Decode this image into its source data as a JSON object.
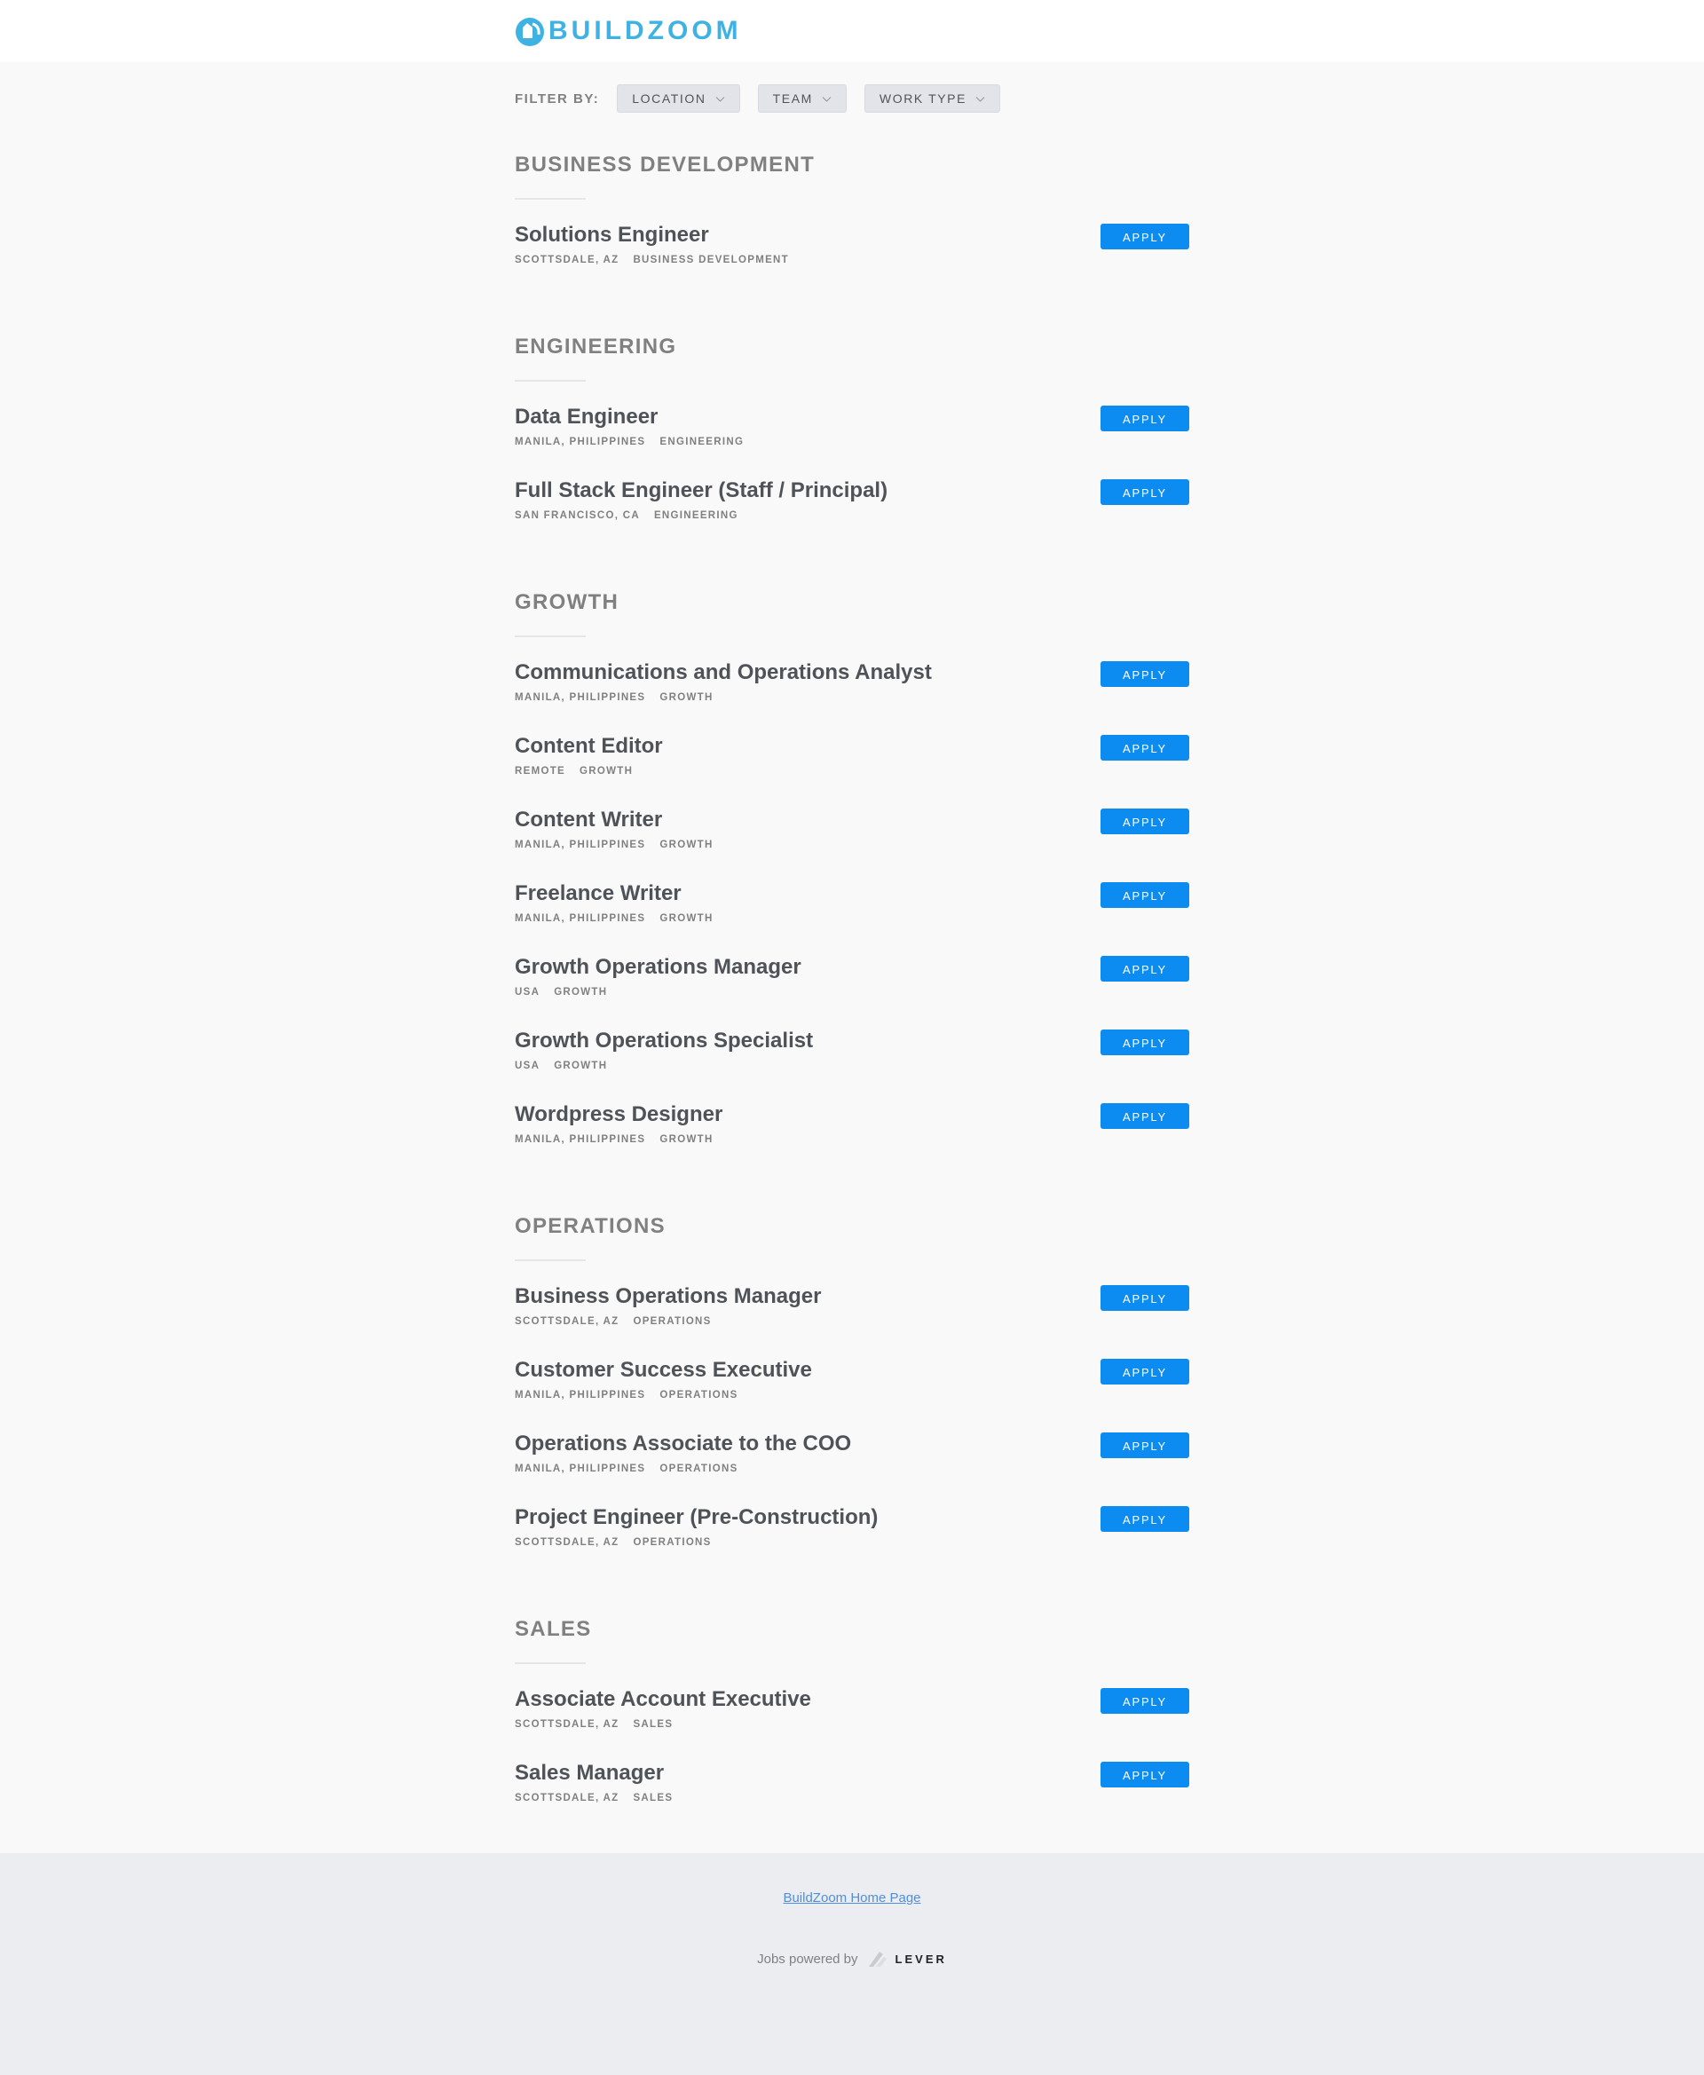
{
  "brand": {
    "name": "BUILDZOOM",
    "color": "#3fb2e4",
    "icon": "buildzoom-logo-icon"
  },
  "filters": {
    "label": "FILTER BY:",
    "buttons": [
      {
        "label": "LOCATION",
        "icon": "chevron-down-icon"
      },
      {
        "label": "TEAM",
        "icon": "chevron-down-icon"
      },
      {
        "label": "WORK TYPE",
        "icon": "chevron-down-icon"
      }
    ]
  },
  "apply_label": "APPLY",
  "apply_color": "#0c8cf0",
  "groups": [
    {
      "title": "BUSINESS DEVELOPMENT",
      "postings": [
        {
          "title": "Solutions Engineer",
          "location": "SCOTTSDALE, AZ",
          "team": "BUSINESS DEVELOPMENT"
        }
      ]
    },
    {
      "title": "ENGINEERING",
      "postings": [
        {
          "title": "Data Engineer",
          "location": "MANILA, PHILIPPINES",
          "team": "ENGINEERING"
        },
        {
          "title": "Full Stack Engineer (Staff / Principal)",
          "location": "SAN FRANCISCO, CA",
          "team": "ENGINEERING"
        }
      ]
    },
    {
      "title": "GROWTH",
      "postings": [
        {
          "title": "Communications and Operations Analyst",
          "location": "MANILA, PHILIPPINES",
          "team": "GROWTH"
        },
        {
          "title": "Content Editor",
          "location": "REMOTE",
          "team": "GROWTH"
        },
        {
          "title": "Content Writer",
          "location": "MANILA, PHILIPPINES",
          "team": "GROWTH"
        },
        {
          "title": "Freelance Writer",
          "location": "MANILA, PHILIPPINES",
          "team": "GROWTH"
        },
        {
          "title": "Growth Operations Manager",
          "location": "USA",
          "team": "GROWTH"
        },
        {
          "title": "Growth Operations Specialist",
          "location": "USA",
          "team": "GROWTH"
        },
        {
          "title": "Wordpress Designer",
          "location": "MANILA, PHILIPPINES",
          "team": "GROWTH"
        }
      ]
    },
    {
      "title": "OPERATIONS",
      "postings": [
        {
          "title": "Business Operations Manager",
          "location": "SCOTTSDALE, AZ",
          "team": "OPERATIONS"
        },
        {
          "title": "Customer Success Executive",
          "location": "MANILA, PHILIPPINES",
          "team": "OPERATIONS"
        },
        {
          "title": "Operations Associate to the COO",
          "location": "MANILA, PHILIPPINES",
          "team": "OPERATIONS"
        },
        {
          "title": "Project Engineer (Pre-Construction)",
          "location": "SCOTTSDALE, AZ",
          "team": "OPERATIONS"
        }
      ]
    },
    {
      "title": "SALES",
      "postings": [
        {
          "title": "Associate Account Executive",
          "location": "SCOTTSDALE, AZ",
          "team": "SALES"
        },
        {
          "title": "Sales Manager",
          "location": "SCOTTSDALE, AZ",
          "team": "SALES"
        }
      ]
    }
  ],
  "footer": {
    "home_link": "BuildZoom Home Page",
    "powered_by": "Jobs powered by",
    "lever_brand": "LEVER",
    "lever_icon": "lever-logo-icon"
  }
}
